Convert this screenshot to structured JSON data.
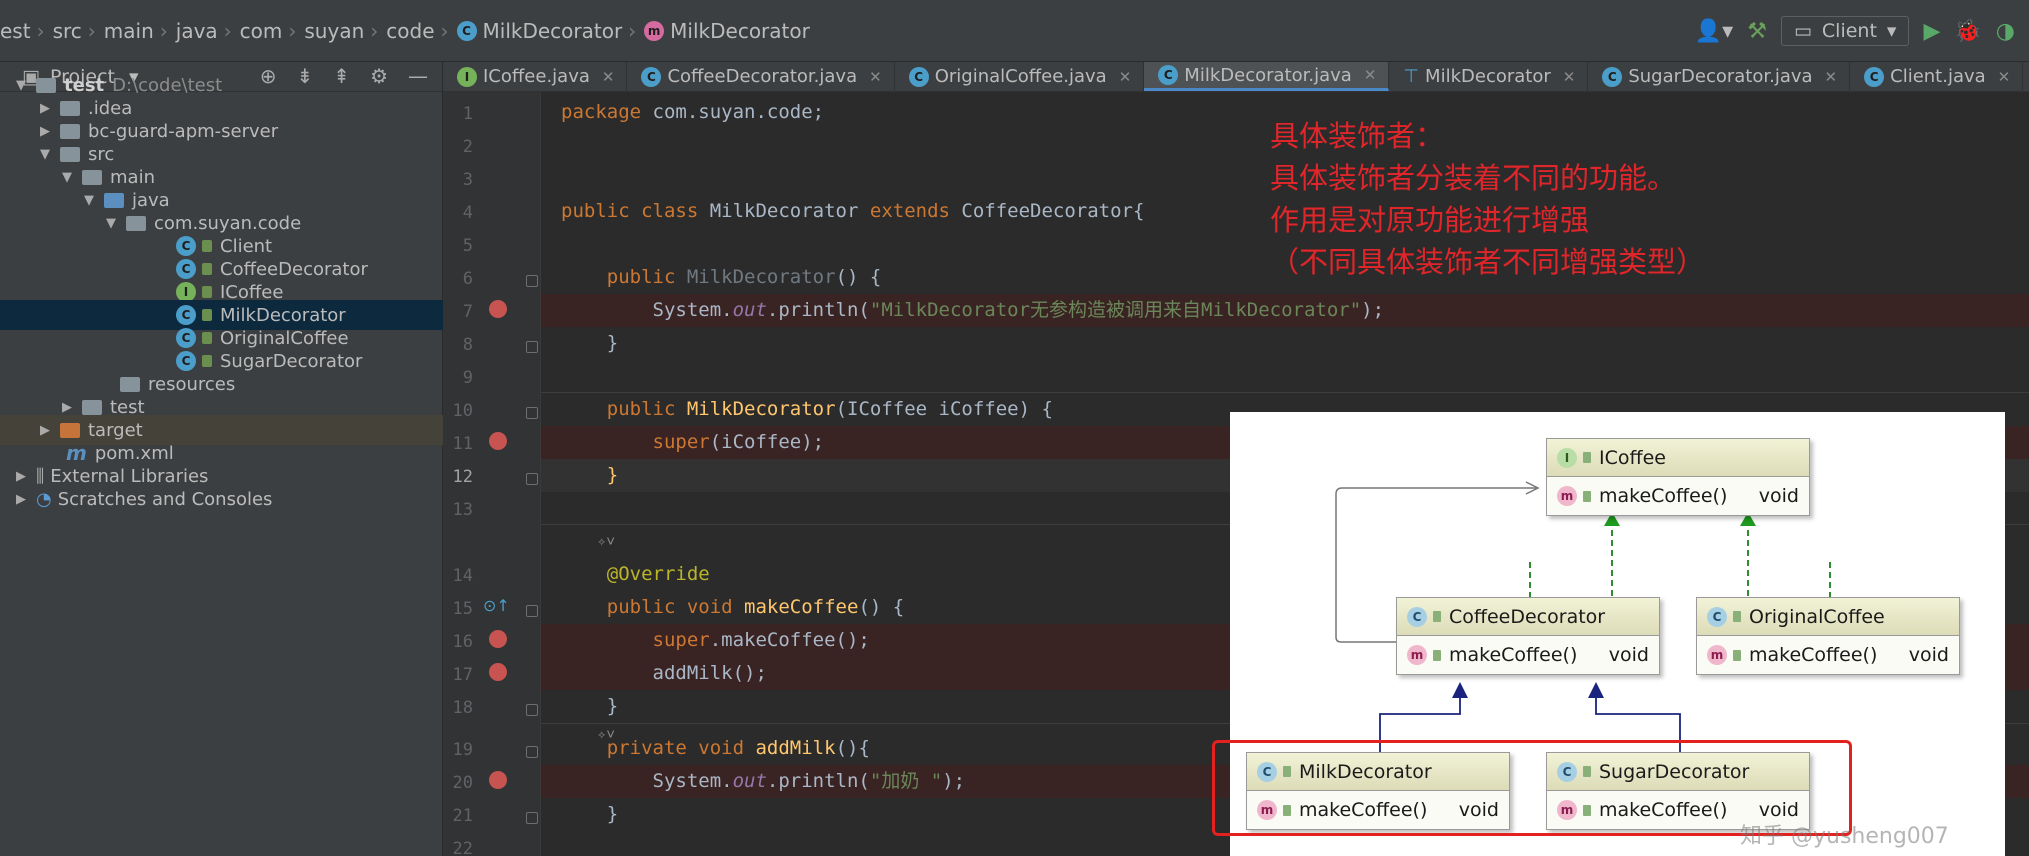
{
  "breadcrumb": {
    "items": [
      "est",
      "src",
      "main",
      "java",
      "com",
      "suyan",
      "code"
    ],
    "file_crumb": "MilkDecorator",
    "member_crumb": "MilkDecorator"
  },
  "toolbar": {
    "run_config": "Client"
  },
  "project": {
    "title": "Project",
    "tree": [
      {
        "label": "test",
        "extra": "D:\\code\\test"
      },
      {
        "label": ".idea"
      },
      {
        "label": "bc-guard-apm-server"
      },
      {
        "label": "src"
      },
      {
        "label": "main"
      },
      {
        "label": "java"
      },
      {
        "label": "com.suyan.code"
      },
      {
        "label": "Client"
      },
      {
        "label": "CoffeeDecorator"
      },
      {
        "label": "ICoffee"
      },
      {
        "label": "MilkDecorator"
      },
      {
        "label": "OriginalCoffee"
      },
      {
        "label": "SugarDecorator"
      },
      {
        "label": "resources"
      },
      {
        "label": "test"
      },
      {
        "label": "target"
      },
      {
        "label": "pom.xml"
      },
      {
        "label": "External Libraries"
      },
      {
        "label": "Scratches and Consoles"
      }
    ]
  },
  "tabs": [
    {
      "label": "ICoffee.java"
    },
    {
      "label": "CoffeeDecorator.java"
    },
    {
      "label": "OriginalCoffee.java"
    },
    {
      "label": "MilkDecorator.java"
    },
    {
      "label": "MilkDecorator"
    },
    {
      "label": "SugarDecorator.java"
    },
    {
      "label": "Client.java"
    }
  ],
  "editor": {
    "line_numbers": [
      "1",
      "2",
      "3",
      "4",
      "5",
      "6",
      "7",
      "8",
      "9",
      "10",
      "11",
      "12",
      "13",
      "14",
      "15",
      "16",
      "17",
      "18",
      "19",
      "20",
      "21",
      "22"
    ],
    "code": {
      "l1_kw": "package",
      "l1_rest": " com.suyan.code;",
      "l4_kw1": "public class",
      "l4_name": " MilkDecorator ",
      "l4_kw2": "extends",
      "l4_rest": " CoffeeDecorator{",
      "l6_kw": "public",
      "l6_fn": " MilkDecorator",
      "l6_rest": "() {",
      "l7_a": "System.",
      "l7_out": "out",
      "l7_b": ".println(",
      "l7_str": "\"MilkDecorator无参构造被调用来自MilkDecorator\"",
      "l7_c": ");",
      "l8": "}",
      "l10_kw": "public",
      "l10_fn": " MilkDecorator",
      "l10_rest": "(ICoffee iCoffee) {",
      "l11_kw": "super",
      "l11_rest": "(iCoffee);",
      "l12": "}",
      "l13_hint": "✧˅",
      "l14_ann": "@Override",
      "l15_kw": "public void",
      "l15_fn": " makeCoffee",
      "l15_rest": "() {",
      "l16_kw": "super",
      "l16_rest": ".makeCoffee();",
      "l17": "addMilk();",
      "l18": "}",
      "l18_hint": "✧˅",
      "l19_kw": "private void",
      "l19_fn": " addMilk",
      "l19_rest": "(){",
      "l20_a": "System.",
      "l20_out": "out",
      "l20_b": ".println(",
      "l20_str": "\"加奶 \"",
      "l20_c": ");",
      "l21": "}"
    }
  },
  "annotation": {
    "line1": "具体装饰者：",
    "line2": "具体装饰者分装着不同的功能。",
    "line3": "作用是对原功能进行增强",
    "line4": "（不同具体装饰者不同增强类型）"
  },
  "uml": {
    "icoffee": {
      "name": "ICoffee",
      "method": "makeCoffee()",
      "ret": "void"
    },
    "coffee_decorator": {
      "name": "CoffeeDecorator",
      "method": "makeCoffee()",
      "ret": "void"
    },
    "original_coffee": {
      "name": "OriginalCoffee",
      "method": "makeCoffee()",
      "ret": "void"
    },
    "milk_decorator": {
      "name": "MilkDecorator",
      "method": "makeCoffee()",
      "ret": "void"
    },
    "sugar_decorator": {
      "name": "SugarDecorator",
      "method": "makeCoffee()",
      "ret": "void"
    },
    "watermark": "知乎 @yusheng007"
  },
  "colors": {
    "annotation_red": "#e3221f",
    "keyword": "#cc7832",
    "function": "#ffc66d",
    "string": "#6a8759",
    "selection": "#0d293e"
  }
}
